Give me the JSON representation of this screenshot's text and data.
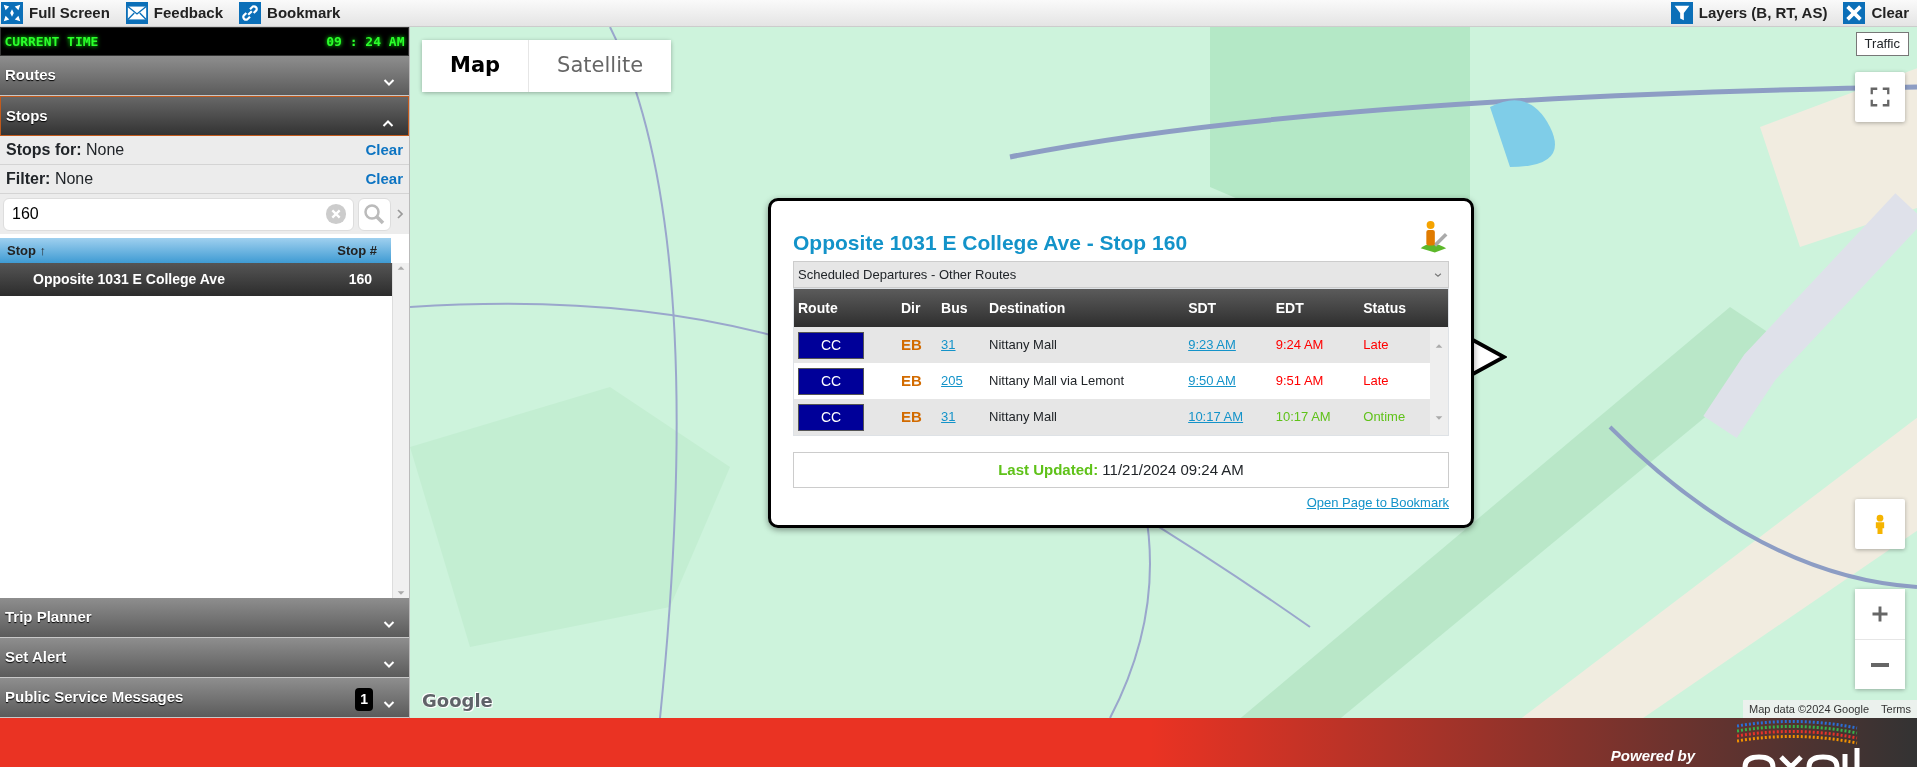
{
  "toolbar": {
    "left_buttons": [
      {
        "label": "Full Screen",
        "kind": "expand"
      },
      {
        "label": "Feedback",
        "kind": "mail"
      },
      {
        "label": "Bookmark",
        "kind": "link"
      }
    ],
    "right_buttons": [
      {
        "label": "Layers (B, RT, AS)",
        "kind": "filter"
      },
      {
        "label": "Clear",
        "kind": "close"
      }
    ]
  },
  "current_time": {
    "label": "CURRENT TIME",
    "value": "09 : 24 AM"
  },
  "sidebar": {
    "sections": [
      {
        "title": "Routes",
        "expanded": false
      },
      {
        "title": "Stops",
        "expanded": true,
        "content": {
          "filters": [
            {
              "label": "Stops for:",
              "value": "None",
              "action": "Clear"
            },
            {
              "label": "Filter:",
              "value": "None",
              "action": "Clear"
            }
          ],
          "search": {
            "value": "160"
          },
          "columns": [
            {
              "label": "Stop",
              "sort_arrow": "↑"
            },
            {
              "label": "Stop #"
            }
          ],
          "rows": [
            {
              "name": "Opposite 1031 E College Ave",
              "number": "160",
              "selected": true
            }
          ]
        }
      },
      {
        "title": "Trip Planner",
        "expanded": false
      },
      {
        "title": "Set Alert",
        "expanded": false
      },
      {
        "title": "Public Service Messages",
        "expanded": false,
        "badge": "1"
      }
    ]
  },
  "map": {
    "type_buttons": [
      {
        "label": "Map",
        "selected": true
      },
      {
        "label": "Satellite",
        "selected": false
      }
    ],
    "traffic_label": "Traffic",
    "attribution": {
      "logo": "Google",
      "data": "Map data ©2024 Google",
      "terms": "Terms"
    },
    "popup": {
      "title": "Opposite 1031 E College Ave - Stop 160",
      "dropdown": "Scheduled Departures - Other Routes",
      "columns": [
        "Route",
        "Dir",
        "Bus",
        "Destination",
        "SDT",
        "EDT",
        "Status"
      ],
      "rows": [
        {
          "route": "CC",
          "dir": "EB",
          "bus": "31",
          "destination": "Nittany Mall",
          "sdt": "9:23 AM",
          "edt": "9:24 AM",
          "status": "Late",
          "kind": "late"
        },
        {
          "route": "CC",
          "dir": "EB",
          "bus": "205",
          "destination": "Nittany Mall via Lemont",
          "sdt": "9:50 AM",
          "edt": "9:51 AM",
          "status": "Late",
          "kind": "late"
        },
        {
          "route": "CC",
          "dir": "EB",
          "bus": "31",
          "destination": "Nittany Mall",
          "sdt": "10:17 AM",
          "edt": "10:17 AM",
          "status": "Ontime",
          "kind": "ontime"
        }
      ],
      "last_updated": {
        "label": "Last Updated:",
        "value": "11/21/2024 09:24 AM"
      },
      "link": "Open Page to Bookmark"
    }
  },
  "footer": {
    "powered_by": "Powered by"
  }
}
